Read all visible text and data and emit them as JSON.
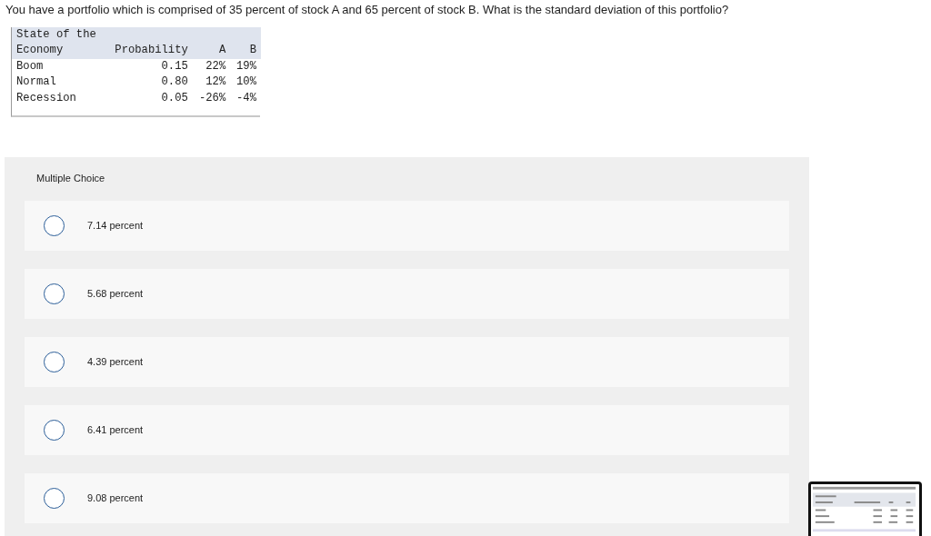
{
  "question": "You have a portfolio which is comprised of 35 percent of stock A and 65 percent of stock B. What is the standard deviation of this portfolio?",
  "table": {
    "header_line_1": "State of the",
    "columns": [
      "Economy",
      "Probability",
      "A",
      "B"
    ],
    "rows": [
      [
        "Boom",
        "0.15",
        "22%",
        "19%"
      ],
      [
        "Normal",
        "0.80",
        "12%",
        "10%"
      ],
      [
        "Recession",
        "0.05",
        "-26%",
        "-4%"
      ]
    ]
  },
  "multiple_choice": {
    "title": "Multiple Choice",
    "options": [
      {
        "label": "7.14 percent",
        "selected": false
      },
      {
        "label": "5.68 percent",
        "selected": false
      },
      {
        "label": "4.39 percent",
        "selected": false
      },
      {
        "label": "6.41 percent",
        "selected": false
      },
      {
        "label": "9.08 percent",
        "selected": false
      }
    ]
  }
}
